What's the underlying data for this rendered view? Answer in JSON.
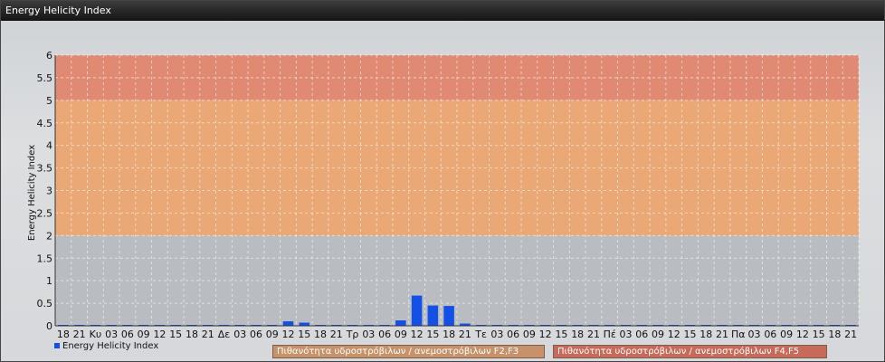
{
  "window": {
    "title": "Energy Helicity Index"
  },
  "colors": {
    "bar": "#1450e6",
    "zone_high": "#e08a74",
    "zone_mid": "#e9a876",
    "zone_low": "#b9bcc0",
    "zone_box_mid": "#c7926a",
    "zone_box_high": "#c76a5a"
  },
  "legend": {
    "series_label": "Energy Helicity Index",
    "zones": [
      {
        "label": "Πιθανότητα υδροστρόβιλων / ανεμοστρόβιλων F2,F3",
        "from": 2,
        "to": 5
      },
      {
        "label": "Πιθανότητα υδροστρόβιλων / ανεμοστρόβιλων F4,F5",
        "from": 5,
        "to": 6
      }
    ]
  },
  "chart_data": {
    "type": "bar",
    "title": "",
    "ylabel": "Energy Helicity Index",
    "xlabel": "",
    "ylim": [
      0,
      6
    ],
    "yticks": [
      "0",
      "0.5",
      "1",
      "1.5",
      "2",
      "2.5",
      "3",
      "3.5",
      "4",
      "4.5",
      "5",
      "5.5",
      "6"
    ],
    "grid": true,
    "legend_position": "bottom-left",
    "categories": [
      "18",
      "21",
      "Κυ",
      "03",
      "06",
      "09",
      "12",
      "15",
      "18",
      "21",
      "Δε",
      "03",
      "06",
      "09",
      "12",
      "15",
      "18",
      "21",
      "Τρ",
      "03",
      "06",
      "09",
      "12",
      "15",
      "18",
      "21",
      "Τε",
      "03",
      "06",
      "09",
      "12",
      "15",
      "18",
      "21",
      "Πέ",
      "03",
      "06",
      "09",
      "12",
      "15",
      "18",
      "21",
      "Πα",
      "03",
      "06",
      "09",
      "12",
      "15",
      "18",
      "21"
    ],
    "series": [
      {
        "name": "Energy Helicity Index",
        "values": [
          0,
          0,
          0,
          0,
          0,
          0,
          0,
          0,
          0,
          0,
          0,
          0,
          0,
          0,
          0.1,
          0.07,
          0,
          0,
          0,
          0,
          0,
          0.12,
          0.67,
          0.45,
          0.44,
          0.05,
          0,
          0,
          0,
          0,
          0,
          0,
          0,
          0,
          0,
          0,
          0,
          0,
          0,
          0,
          0,
          0,
          0,
          0,
          0,
          0,
          0,
          0,
          0,
          0
        ]
      }
    ]
  }
}
